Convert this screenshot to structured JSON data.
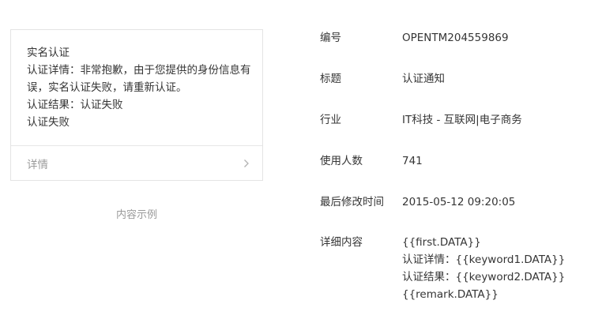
{
  "preview": {
    "lines": [
      "实名认证",
      "认证详情：非常抱歉，由于您提供的身份信息有误，实名认证失败，请重新认证。",
      "认证结果：认证失败",
      "认证失败"
    ],
    "detail_label": "详情",
    "caption": "内容示例"
  },
  "info": {
    "id": {
      "label": "编号",
      "value": "OPENTM204559869"
    },
    "title": {
      "label": "标题",
      "value": "认证通知"
    },
    "industry": {
      "label": "行业",
      "value": "IT科技 - 互联网|电子商务"
    },
    "users": {
      "label": "使用人数",
      "value": "741"
    },
    "modified": {
      "label": "最后修改时间",
      "value": "2015-05-12 09:20:05"
    },
    "content": {
      "label": "详细内容",
      "lines": [
        "{{first.DATA}}",
        "认证详情：{{keyword1.DATA}}",
        "认证结果：{{keyword2.DATA}}",
        "{{remark.DATA}}"
      ]
    }
  },
  "icons": {
    "detail_arrow": "chevron-right-icon"
  },
  "colors": {
    "text": "#353535",
    "muted": "#9a9a9a",
    "border": "#e4e4e4"
  }
}
